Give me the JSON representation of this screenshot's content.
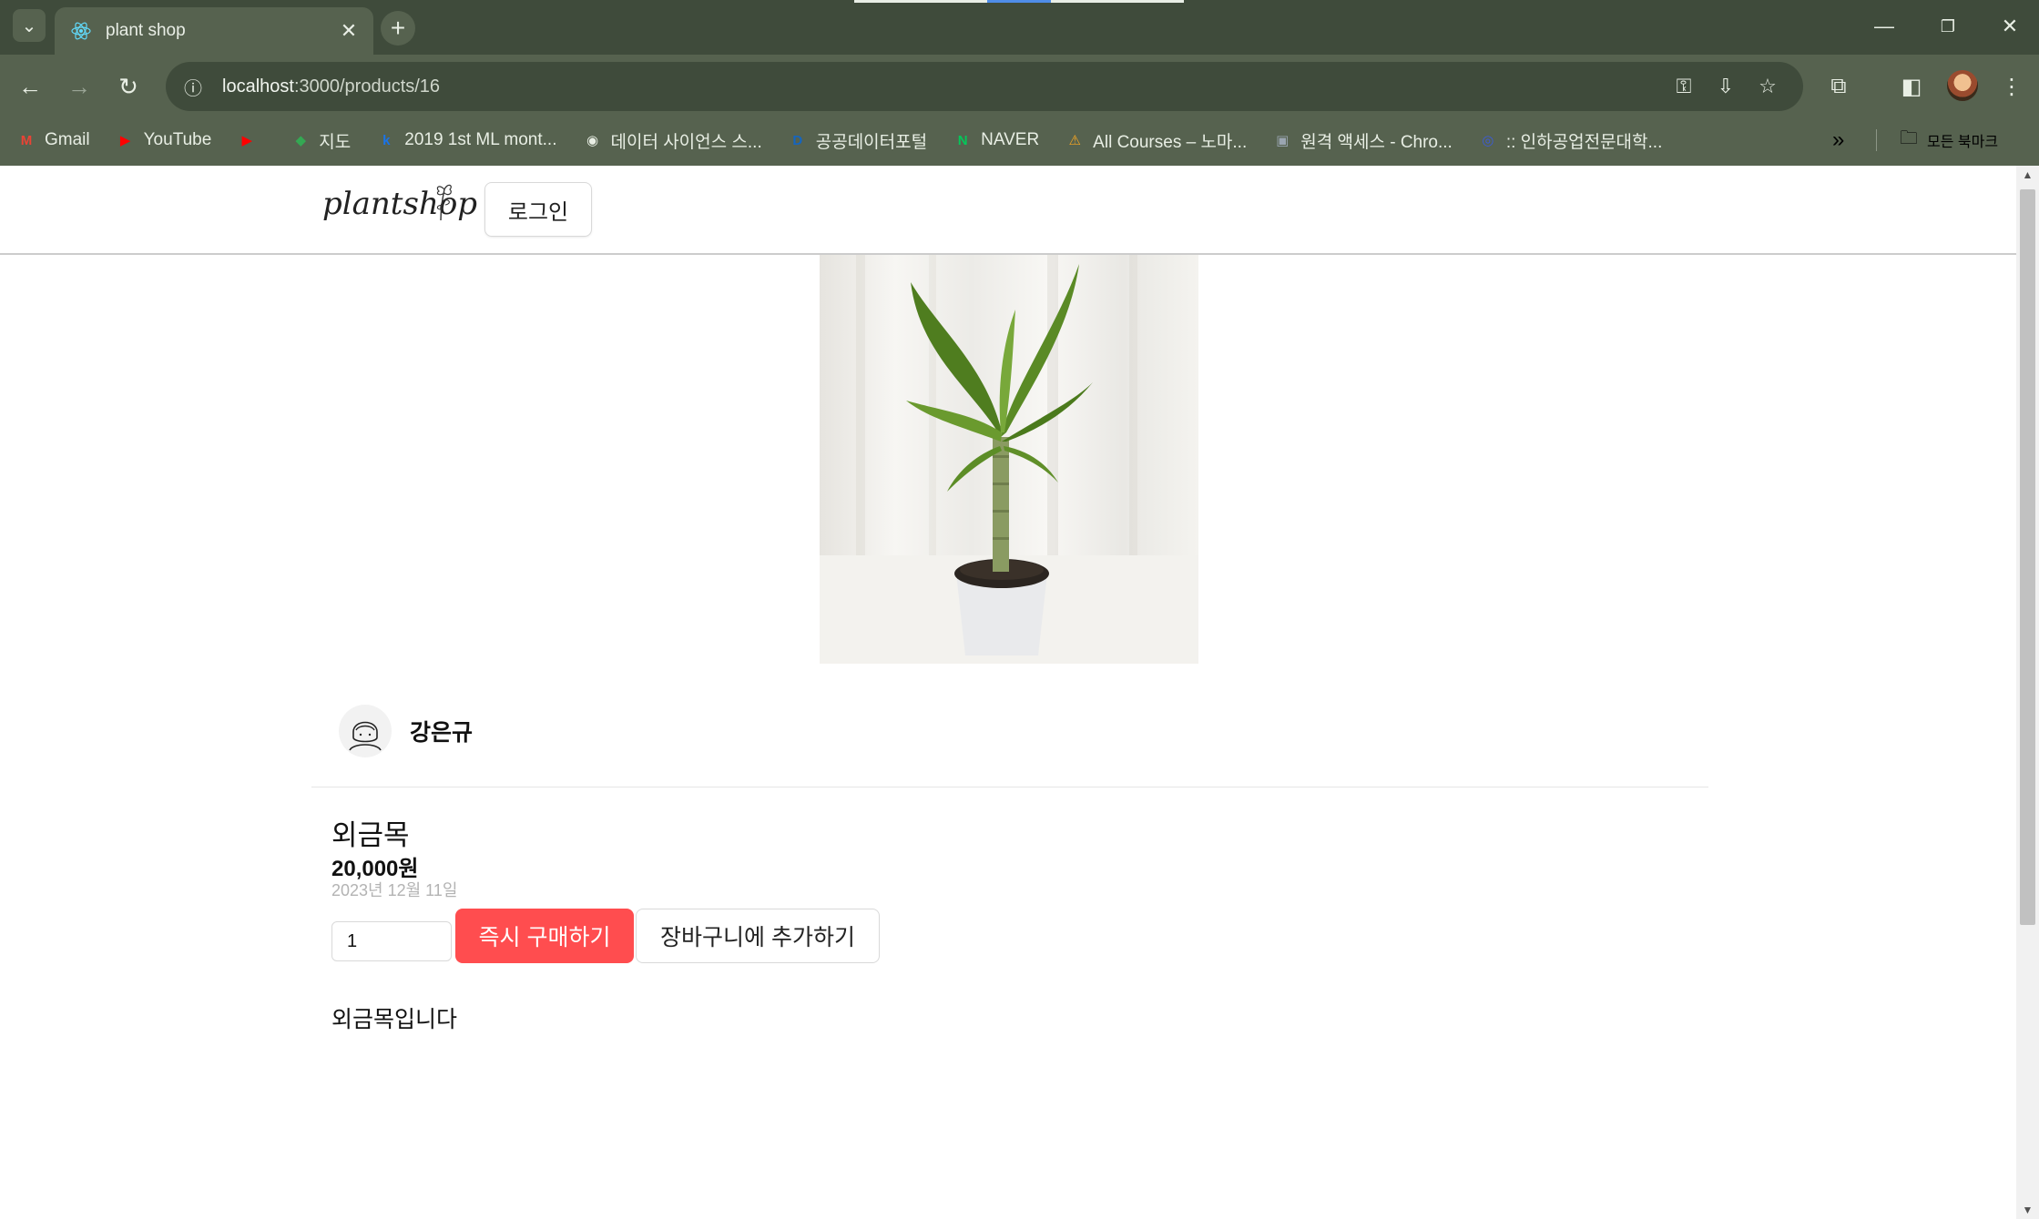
{
  "browser": {
    "tab_title": "plant shop",
    "url_host": "localhost",
    "url_path": ":3000/products/16",
    "bookmarks": [
      {
        "label": "Gmail",
        "icon": "gmail-icon",
        "color": "#ea4335",
        "glyph": "M"
      },
      {
        "label": "YouTube",
        "icon": "youtube-icon",
        "color": "#ff0000",
        "glyph": "▶"
      },
      {
        "label": "",
        "icon": "youtube-icon",
        "color": "#ff0000",
        "glyph": "▶"
      },
      {
        "label": "지도",
        "icon": "maps-icon",
        "color": "#34a853",
        "glyph": "◆"
      },
      {
        "label": "2019 1st ML mont...",
        "icon": "k-icon",
        "color": "#1a73e8",
        "glyph": "k"
      },
      {
        "label": "데이터 사이언스 스...",
        "icon": "globe-icon",
        "color": "#e8eee4",
        "glyph": "◉"
      },
      {
        "label": "공공데이터포털",
        "icon": "data-portal-icon",
        "color": "#1565c0",
        "glyph": "D"
      },
      {
        "label": "NAVER",
        "icon": "naver-icon",
        "color": "#03c75a",
        "glyph": "N"
      },
      {
        "label": "All Courses – 노마...",
        "icon": "nomad-icon",
        "color": "#f5a623",
        "glyph": "⚠"
      },
      {
        "label": "원격 액세스 - Chro...",
        "icon": "remote-access-icon",
        "color": "#9aa5b1",
        "glyph": "▣"
      },
      {
        "label": ":: 인하공업전문대학...",
        "icon": "school-icon",
        "color": "#3b5bdb",
        "glyph": "◎"
      }
    ],
    "bookmarks_folder": "모든 북마크"
  },
  "header": {
    "logo_text": "plantshop",
    "login_label": "로그인"
  },
  "product": {
    "seller_name": "강은규",
    "name": "외금목",
    "price": "20,000원",
    "date": "2023년 12월 11일",
    "quantity": "1",
    "buy_label": "즉시 구매하기",
    "cart_label": "장바구니에 추가하기",
    "description": "외금목입니다"
  },
  "colors": {
    "chrome_dark": "#3f4b3b",
    "chrome_light": "#56624f",
    "buy_button": "#ff4d4f"
  }
}
